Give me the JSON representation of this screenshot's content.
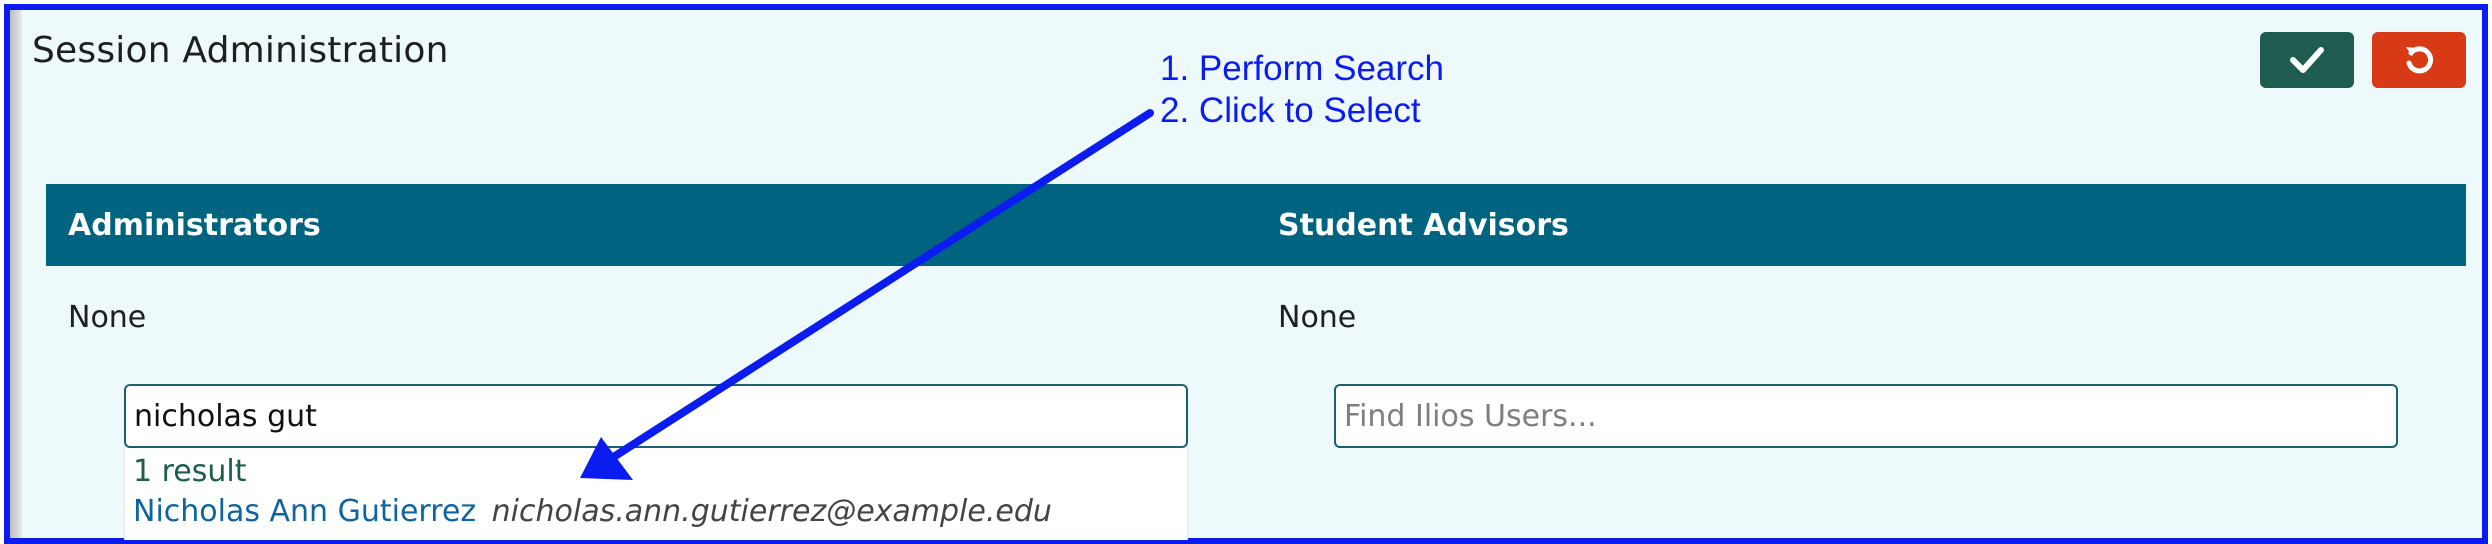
{
  "page": {
    "title": "Session Administration"
  },
  "actions": {
    "save_icon": "check-icon",
    "cancel_icon": "undo-icon"
  },
  "columns": {
    "administrators": {
      "label": "Administrators",
      "value": "None",
      "search": {
        "value": "nicholas gut",
        "placeholder": ""
      },
      "results": {
        "count": "1 result",
        "items": [
          {
            "name": "Nicholas Ann Gutierrez",
            "email": "nicholas.ann.gutierrez@example.edu"
          }
        ]
      }
    },
    "student_advisors": {
      "label": "Student Advisors",
      "value": "None",
      "search": {
        "value": "",
        "placeholder": "Find Ilios Users..."
      }
    }
  },
  "annotation": {
    "line1": "1. Perform Search",
    "line2": "2. Click to Select"
  },
  "colors": {
    "annotation": "#0b1cf0",
    "header": "#006380",
    "save": "#1d5c4e",
    "cancel": "#d83a15",
    "background": "#eef9fc"
  }
}
